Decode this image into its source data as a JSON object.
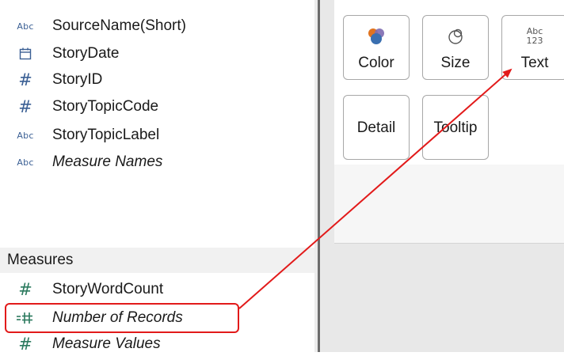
{
  "dimensions": {
    "items": [
      {
        "icon": "abc-icon",
        "label": "SourceName(Short)",
        "italic": false
      },
      {
        "icon": "calendar-icon",
        "label": "StoryDate",
        "italic": false
      },
      {
        "icon": "hash-icon",
        "label": "StoryID",
        "italic": false
      },
      {
        "icon": "hash-icon",
        "label": "StoryTopicCode",
        "italic": false
      },
      {
        "icon": "abc-icon",
        "label": "StoryTopicLabel",
        "italic": false
      },
      {
        "icon": "abc-icon",
        "label": "Measure Names",
        "italic": true
      }
    ]
  },
  "measures": {
    "header": "Measures",
    "items": [
      {
        "icon": "hash-icon",
        "label": "StoryWordCount",
        "italic": false
      },
      {
        "icon": "calculated-hash-icon",
        "label": "Number of Records",
        "italic": true,
        "highlighted": true
      },
      {
        "icon": "hash-icon",
        "label": "Measure Values",
        "italic": true
      }
    ]
  },
  "icon_text": {
    "abc": "Abc",
    "hash": "#",
    "text_mark_top": "Abc",
    "text_mark_bottom": "123"
  },
  "marks": {
    "buttons": [
      {
        "id": "color",
        "label": "Color",
        "icon": "color-circles-icon"
      },
      {
        "id": "size",
        "label": "Size",
        "icon": "size-circles-icon"
      },
      {
        "id": "text",
        "label": "Text",
        "icon": "abc-123-icon"
      },
      {
        "id": "detail",
        "label": "Detail",
        "icon": ""
      },
      {
        "id": "tooltip",
        "label": "Tooltip",
        "icon": ""
      }
    ]
  },
  "annotation": {
    "color": "#e21a1a",
    "from": "number-of-records",
    "to": "text-mark-button"
  },
  "colors": {
    "dimension_icon": "#3a5f94",
    "measure_icon": "#2b7a5e",
    "color_mark_orange": "#e0731f",
    "color_mark_blue": "#3a6fb0",
    "color_mark_purple": "#7d6ab0"
  }
}
